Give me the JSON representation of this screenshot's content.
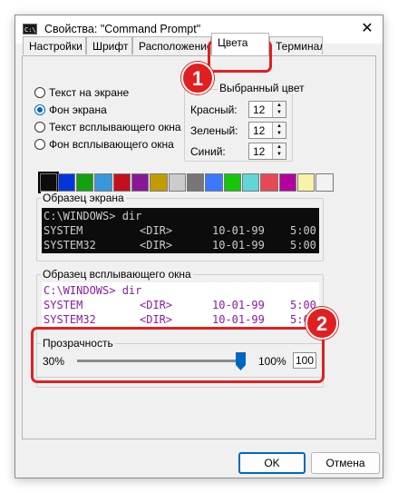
{
  "window": {
    "title": "Свойства: \"Command Prompt\"",
    "app_icon_text": "C:\\.",
    "close_glyph": "✕"
  },
  "tabs": [
    {
      "label": "Настройки",
      "active": false
    },
    {
      "label": "Шрифт",
      "active": false
    },
    {
      "label": "Расположение",
      "active": false
    },
    {
      "label": "Цвета",
      "active": true
    },
    {
      "label": "Терминал",
      "active": false
    }
  ],
  "color_target": {
    "options": [
      {
        "label": "Текст на экране",
        "selected": false
      },
      {
        "label": "Фон экрана",
        "selected": true
      },
      {
        "label": "Текст всплывающего окна",
        "selected": false
      },
      {
        "label": "Фон всплывающего окна",
        "selected": false
      }
    ]
  },
  "selected_color": {
    "legend": "Выбранный цвет",
    "fields": [
      {
        "label": "Красный:",
        "value": "12"
      },
      {
        "label": "Зеленый:",
        "value": "12"
      },
      {
        "label": "Синий:",
        "value": "12"
      }
    ]
  },
  "palette": [
    "#0c0c0c",
    "#0037da",
    "#13a10e",
    "#3a96dd",
    "#c50f1f",
    "#881798",
    "#c19c00",
    "#cccccc",
    "#767676",
    "#3b78ff",
    "#16c60c",
    "#61d6d6",
    "#e74856",
    "#b4009e",
    "#f9f1a5",
    "#f2f2f2"
  ],
  "screen_preview": {
    "legend": "Образец экрана",
    "lines": [
      {
        "c0": "C:\\WINDOWS> dir",
        "c1": "",
        "c2": "",
        "c3": ""
      },
      {
        "c0": "SYSTEM",
        "c1": "<DIR>",
        "c2": "10-01-99",
        "c3": "5:00"
      },
      {
        "c0": "SYSTEM32",
        "c1": "<DIR>",
        "c2": "10-01-99",
        "c3": "5:00"
      }
    ],
    "text_color": "#cccccc",
    "bg_color": "#0c0c0c"
  },
  "popup_preview": {
    "legend": "Образец всплывающего окна",
    "lines": [
      {
        "c0": "C:\\WINDOWS> dir",
        "c1": "",
        "c2": "",
        "c3": ""
      },
      {
        "c0": "SYSTEM",
        "c1": "<DIR>",
        "c2": "10-01-99",
        "c3": "5:00"
      },
      {
        "c0": "SYSTEM32",
        "c1": "<DIR>",
        "c2": "10-01-99",
        "c3": "5:00"
      }
    ],
    "text_color": "#8b1ca3",
    "bg_color": "#ffffff"
  },
  "opacity": {
    "legend": "Прозрачность",
    "min_label": "30%",
    "max_label": "100%",
    "value": "100",
    "level_fraction": 1.0
  },
  "buttons": {
    "ok": "OK",
    "cancel": "Отмена"
  },
  "annotations": [
    {
      "number": "1"
    },
    {
      "number": "2"
    }
  ],
  "accent_color": "#0067c0",
  "annotation_color": "#e02020"
}
